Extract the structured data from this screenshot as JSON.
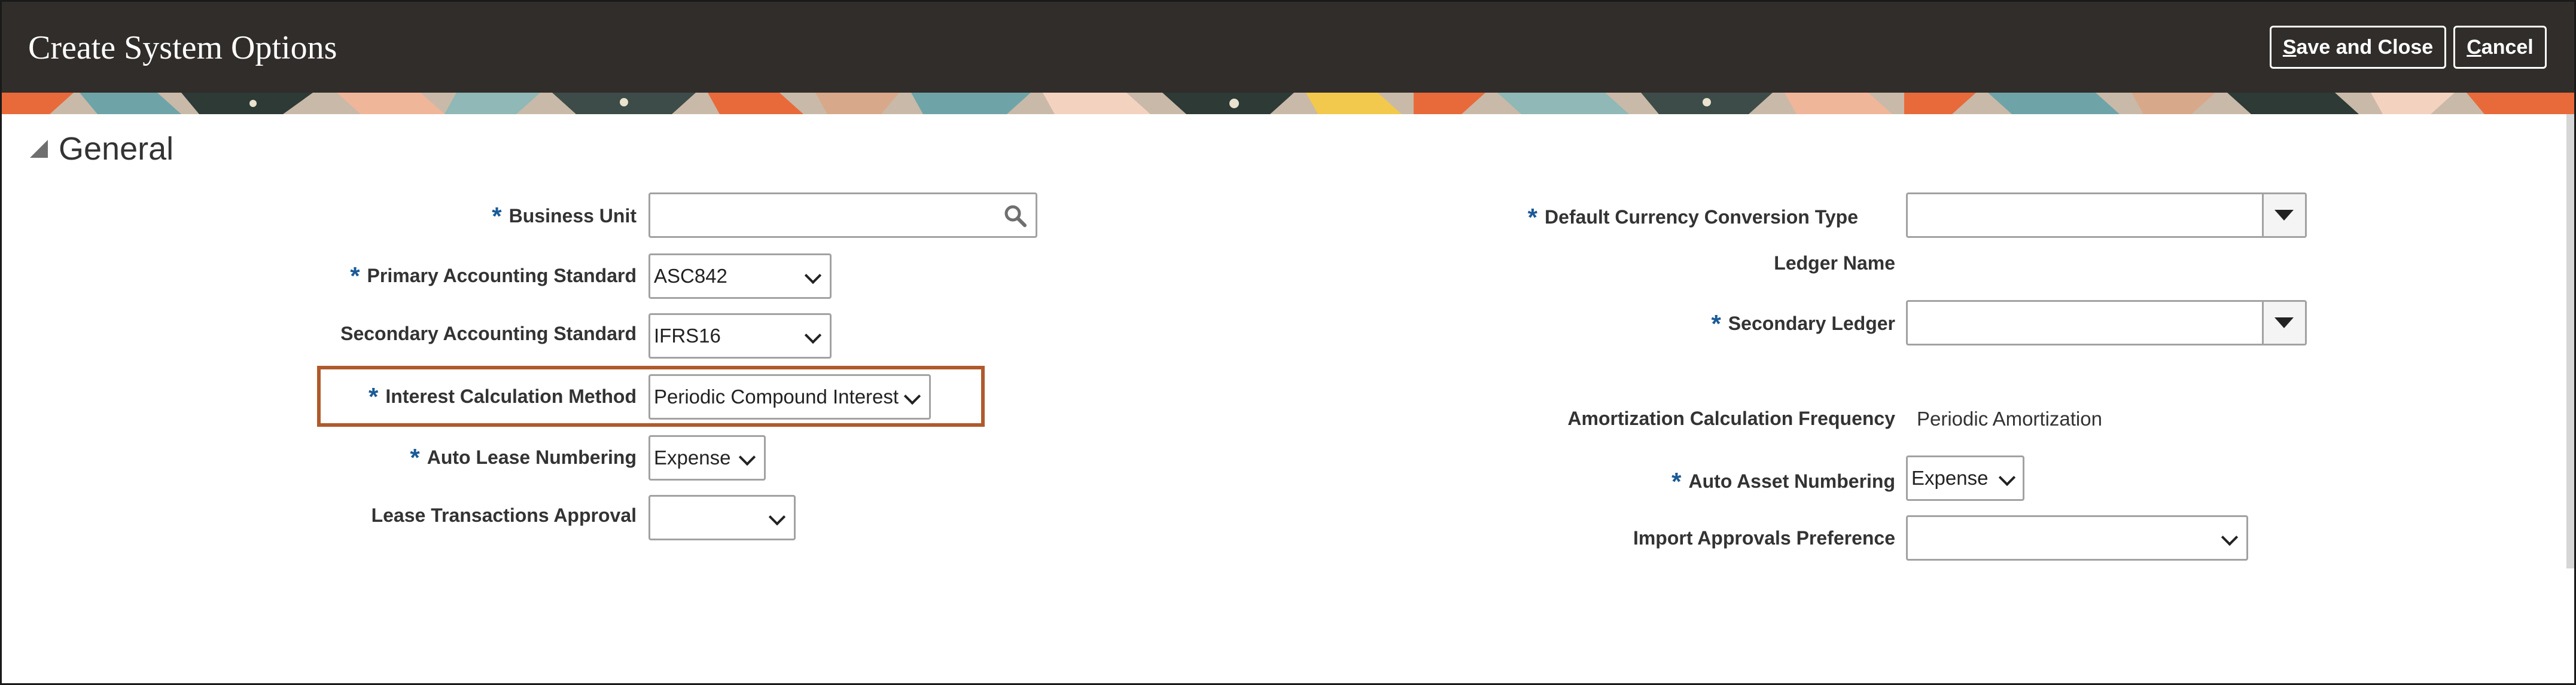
{
  "header": {
    "title": "Create System Options",
    "save_close_accel": "S",
    "save_close_rest": "ave and Close",
    "cancel_accel": "C",
    "cancel_rest": "ancel"
  },
  "section": {
    "title": "General"
  },
  "left": {
    "business_unit": {
      "label": "Business Unit",
      "required": "*",
      "value": ""
    },
    "primary_standard": {
      "label": "Primary Accounting Standard",
      "required": "*",
      "value": "ASC842"
    },
    "secondary_standard": {
      "label": "Secondary Accounting Standard",
      "value": "IFRS16"
    },
    "interest_method": {
      "label": "Interest Calculation Method",
      "required": "*",
      "value": "Periodic Compound Interest"
    },
    "auto_lease_numbering": {
      "label": "Auto Lease Numbering",
      "required": "*",
      "value": "Expense"
    },
    "lease_approval": {
      "label": "Lease Transactions Approval",
      "value": ""
    }
  },
  "right": {
    "conversion_type": {
      "label": "Default Currency Conversion Type",
      "required": "*",
      "value": ""
    },
    "ledger_name": {
      "label": "Ledger Name",
      "value": ""
    },
    "secondary_ledger": {
      "label": "Secondary Ledger",
      "required": "*",
      "value": ""
    },
    "amortization_frequency": {
      "label": "Amortization Calculation Frequency",
      "value": "Periodic Amortization"
    },
    "auto_asset_numbering": {
      "label": "Auto Asset Numbering",
      "required": "*",
      "value": "Expense"
    },
    "import_approvals": {
      "label": "Import Approvals Preference",
      "value": ""
    }
  },
  "colors": {
    "header_bg": "#312d2a",
    "required_mark": "#1a5a96",
    "highlight_border": "#b05a2c"
  }
}
